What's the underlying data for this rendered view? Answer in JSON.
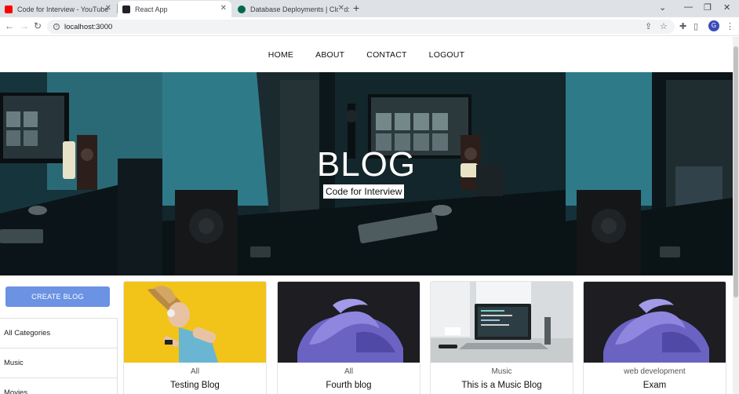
{
  "browser": {
    "tabs": [
      {
        "label": "Code for Interview - YouTube",
        "color": "#ff0000"
      },
      {
        "label": "React App",
        "color": "#20232a"
      },
      {
        "label": "Database Deployments | Cloud: M",
        "color": "#00684a"
      }
    ],
    "url": "localhost:3000",
    "profile_initial": "G"
  },
  "nav": {
    "links": [
      "HOME",
      "ABOUT",
      "CONTACT",
      "LOGOUT"
    ]
  },
  "banner": {
    "title": "BLOG",
    "subtitle": "Code for Interview"
  },
  "sidebar": {
    "create_label": "CREATE BLOG",
    "accent": "#6b92e3",
    "categories": [
      "All Categories",
      "Music",
      "Movies"
    ]
  },
  "posts": [
    {
      "category": "All",
      "title": "Testing Blog",
      "image": "girl-headphones-yellow"
    },
    {
      "category": "All",
      "title": "Fourth blog",
      "image": "purple-abstract"
    },
    {
      "category": "Music",
      "title": "This is a Music Blog",
      "image": "laptop-desk"
    },
    {
      "category": "web development",
      "title": "Exam",
      "image": "purple-abstract"
    }
  ]
}
